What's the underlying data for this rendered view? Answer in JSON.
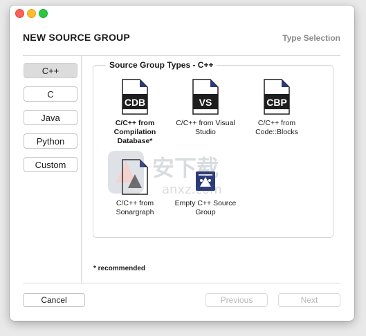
{
  "window": {
    "title": "NEW SOURCE GROUP",
    "step": "Type Selection"
  },
  "languages": {
    "items": [
      {
        "label": "C++",
        "selected": true
      },
      {
        "label": "C",
        "selected": false
      },
      {
        "label": "Java",
        "selected": false
      },
      {
        "label": "Python",
        "selected": false
      },
      {
        "label": "Custom",
        "selected": false
      }
    ]
  },
  "source_group": {
    "title": "Source Group Types - C++",
    "types": [
      {
        "icon_text": "CDB",
        "icon": "cdb-file-icon",
        "label": "C/C++ from Compilation Database*",
        "recommended": true
      },
      {
        "icon_text": "VS",
        "icon": "visual-studio-file-icon",
        "label": "C/C++ from Visual Studio"
      },
      {
        "icon_text": "CBP",
        "icon": "cbp-file-icon",
        "label": "C/C++ from Code::Blocks"
      },
      {
        "icon_text": "",
        "icon": "sonargraph-file-icon",
        "label": "C/C++ from Sonargraph"
      },
      {
        "icon_text": "",
        "icon": "empty-group-icon",
        "label": "Empty C++ Source Group"
      }
    ]
  },
  "footnote": "* recommended",
  "buttons": {
    "cancel": "Cancel",
    "previous": "Previous",
    "next": "Next"
  },
  "watermark": {
    "text": "安下载",
    "subtext": "anxz.com"
  },
  "colors": {
    "selected_tab": "#dcdcdc",
    "icon_dark": "#1e1e1e",
    "icon_accent": "#2b3a7a",
    "disabled_text": "#b9b9b9"
  }
}
